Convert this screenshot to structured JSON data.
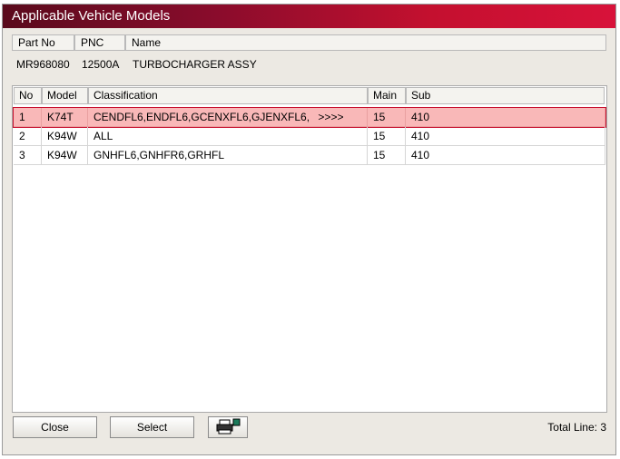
{
  "window": {
    "title": "Applicable Vehicle Models"
  },
  "part": {
    "headers": {
      "part_no": "Part No",
      "pnc": "PNC",
      "name": "Name"
    },
    "values": {
      "part_no": "MR968080",
      "pnc": "12500A",
      "name": "TURBOCHARGER ASSY"
    }
  },
  "list": {
    "headers": {
      "no": "No",
      "model": "Model",
      "classification": "Classification",
      "main": "Main",
      "sub": "Sub"
    },
    "rows": [
      {
        "no": "1",
        "model": "K74T",
        "classification": "CENDFL6,ENDFL6,GCENXFL6,GJENXFL6,",
        "more": ">>>>",
        "main": "15",
        "sub": "410",
        "selected": true
      },
      {
        "no": "2",
        "model": "K94W",
        "classification": "ALL",
        "more": "",
        "main": "15",
        "sub": "410",
        "selected": false
      },
      {
        "no": "3",
        "model": "K94W",
        "classification": "GNHFL6,GNHFR6,GRHFL",
        "more": "",
        "main": "15",
        "sub": "410",
        "selected": false
      }
    ]
  },
  "buttons": {
    "close": "Close",
    "select": "Select",
    "print_icon": "printer-icon"
  },
  "footer": {
    "total_line": "Total Line: 3"
  },
  "colors": {
    "title_start": "#5a0a1c",
    "title_end": "#d8123a",
    "selected_row": "#f9b8b8",
    "selected_outline": "#c8102e"
  }
}
